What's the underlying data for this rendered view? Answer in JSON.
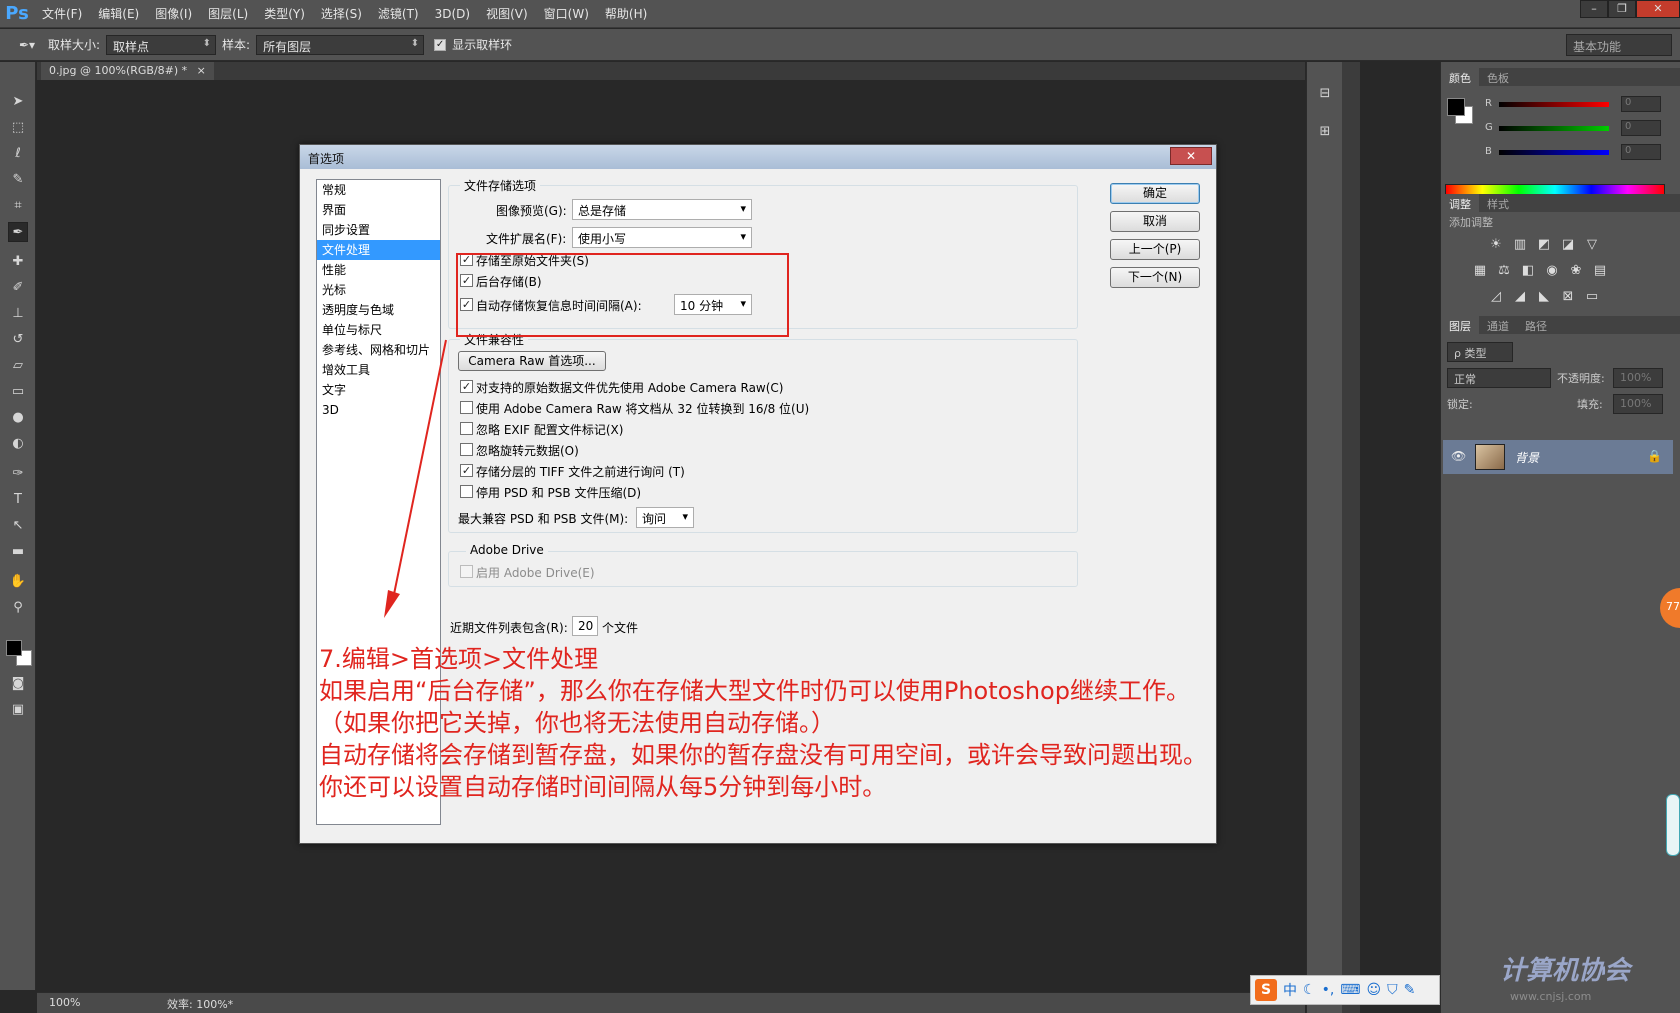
{
  "app": {
    "logo": "Ps",
    "menus": [
      "文件(F)",
      "编辑(E)",
      "图像(I)",
      "图层(L)",
      "类型(Y)",
      "选择(S)",
      "滤镜(T)",
      "3D(D)",
      "视图(V)",
      "窗口(W)",
      "帮助(H)"
    ],
    "window_controls": [
      "–",
      "❐",
      "✕"
    ]
  },
  "options_bar": {
    "sample_size_label": "取样大小:",
    "sample_size_value": "取样点",
    "sample_label": "样本:",
    "sample_value": "所有图层",
    "show_ring_label": "显示取样环",
    "show_ring_checked": true,
    "workspace": "基本功能"
  },
  "document": {
    "tab_title": "0.jpg @ 100%(RGB/8#) *",
    "tab_close": "×"
  },
  "status_bar": {
    "zoom": "100%",
    "efficiency": "效率: 100%*"
  },
  "panels": {
    "color_tabs": [
      "颜色",
      "色板"
    ],
    "rgb": [
      {
        "label": "R",
        "value": "0",
        "color": "#ff0000"
      },
      {
        "label": "G",
        "value": "0",
        "color": "#00c800"
      },
      {
        "label": "B",
        "value": "0",
        "color": "#0000ff"
      }
    ],
    "adjust_tabs": [
      "调整",
      "样式"
    ],
    "add_adjustment": "添加调整",
    "layers_tabs": [
      "图层",
      "通道",
      "路径"
    ],
    "kind_label": "ρ 类型",
    "blend_mode": "正常",
    "opacity_label": "不透明度:",
    "opacity_value": "100%",
    "lock_label": "锁定:",
    "fill_label": "填充:",
    "fill_value": "100%",
    "layer_name": "背景"
  },
  "dialog": {
    "title": "首选项",
    "close": "✕",
    "categories": [
      "常规",
      "界面",
      "同步设置",
      "文件处理",
      "性能",
      "光标",
      "透明度与色域",
      "单位与标尺",
      "参考线、网格和切片",
      "增效工具",
      "文字",
      "3D"
    ],
    "selected_category": 3,
    "file_save": {
      "title": "文件存储选项",
      "preview_label": "图像预览(G):",
      "preview_value": "总是存储",
      "ext_label": "文件扩展名(F):",
      "ext_value": "使用小写",
      "save_original_label": "存储至原始文件夹(S)",
      "save_original_checked": true,
      "background_save_label": "后台存储(B)",
      "background_save_checked": true,
      "autosave_label": "自动存储恢复信息时间间隔(A):",
      "autosave_checked": true,
      "autosave_value": "10 分钟"
    },
    "compat": {
      "title": "文件兼容性",
      "camera_raw_button": "Camera Raw 首选项...",
      "items": [
        {
          "label": "对支持的原始数据文件优先使用 Adobe Camera Raw(C)",
          "checked": true
        },
        {
          "label": "使用 Adobe Camera Raw 将文档从 32 位转换到 16/8 位(U)",
          "checked": false
        },
        {
          "label": "忽略 EXIF 配置文件标记(X)",
          "checked": false
        },
        {
          "label": "忽略旋转元数据(O)",
          "checked": false
        },
        {
          "label": "存储分层的 TIFF 文件之前进行询问 (T)",
          "checked": true
        },
        {
          "label": "停用 PSD 和 PSB 文件压缩(D)",
          "checked": false
        }
      ],
      "max_compat_label": "最大兼容 PSD 和 PSB 文件(M):",
      "max_compat_value": "询问"
    },
    "adobe_drive": {
      "title": "Adobe Drive",
      "enable_label": "启用 Adobe Drive(E)",
      "checked": false
    },
    "recent_label": "近期文件列表包含(R):",
    "recent_value": "20",
    "recent_unit": "个文件",
    "buttons": {
      "ok": "确定",
      "cancel": "取消",
      "prev": "上一个(P)",
      "next": "下一个(N)"
    }
  },
  "annotation": {
    "color": "#e0251f",
    "lines": [
      "7.编辑>首选项>文件处理",
      "如果启用“后台存储”，那么你在存储大型文件时仍可以使用Photoshop继续工作。",
      "（如果你把它关掉，你也将无法使用自动存储。）",
      "自动存储将会存储到暂存盘，如果你的暂存盘没有可用空间，或许会导致问题出现。",
      "你还可以设置自动存储时间间隔从每5分钟到每小时。"
    ]
  },
  "tray": {
    "ime": "S",
    "ime_lang": "中"
  },
  "watermark": {
    "text": "计算机协会",
    "sub": "www.cnjsj.com"
  },
  "side_badge": "77"
}
